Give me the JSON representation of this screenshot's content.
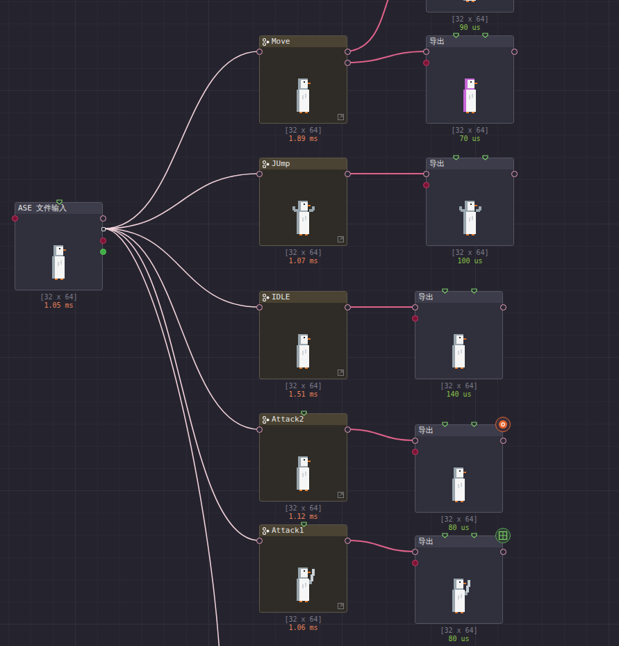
{
  "canvas": {
    "nodes": [
      {
        "title": "",
        "kind": "partial",
        "size": "[32 x 64]",
        "time": "90 us",
        "time_color": "#8bc34a",
        "sprite": "idle",
        "outputs": 1,
        "top_port": false,
        "badge": "none"
      },
      {
        "title": "Move",
        "kind": "animation",
        "size": "[32 x 64]",
        "time": "1.89 ms",
        "time_color": "#e8825a",
        "sprite": "idle",
        "outputs": 2,
        "top_port": false,
        "badge": "none"
      },
      {
        "title": "导出",
        "kind": "export",
        "size": "[32 x 64]",
        "time": "70 us",
        "time_color": "#8bc34a",
        "sprite": "tinted",
        "outputs": 1,
        "top_port": true,
        "badge": "none"
      },
      {
        "title": "JUmp",
        "kind": "animation",
        "size": "[32 x 64]",
        "time": "1.07 ms",
        "time_color": "#e8825a",
        "sprite": "wings",
        "outputs": 1,
        "top_port": false,
        "badge": "none"
      },
      {
        "title": "导出",
        "kind": "export",
        "size": "[32 x 64]",
        "time": "100 us",
        "time_color": "#8bc34a",
        "sprite": "wings",
        "outputs": 1,
        "top_port": true,
        "badge": "none"
      },
      {
        "title": "ASE 文件输入",
        "kind": "input",
        "size": "[32 x 64]",
        "time": "1.05 ms",
        "time_color": "#e8825a",
        "sprite": "idle",
        "outputs": 4,
        "top_port": true,
        "badge": "none"
      },
      {
        "title": "IDLE",
        "kind": "animation",
        "size": "[32 x 64]",
        "time": "1.51 ms",
        "time_color": "#e8825a",
        "sprite": "idle",
        "outputs": 1,
        "top_port": false,
        "badge": "none"
      },
      {
        "title": "导出",
        "kind": "export",
        "size": "[32 x 64]",
        "time": "140 us",
        "time_color": "#8bc34a",
        "sprite": "idle",
        "outputs": 1,
        "top_port": true,
        "badge": "none"
      },
      {
        "title": "Attack2",
        "kind": "animation",
        "size": "[32 x 64]",
        "time": "1.12 ms",
        "time_color": "#e8825a",
        "sprite": "idle",
        "outputs": 1,
        "top_port": true,
        "badge": "none"
      },
      {
        "title": "导出",
        "kind": "export",
        "size": "[32 x 64]",
        "time": "80 us",
        "time_color": "#8bc34a",
        "sprite": "idle",
        "outputs": 1,
        "top_port": true,
        "badge": "eye"
      },
      {
        "title": "Attack1",
        "kind": "animation",
        "size": "[32 x 64]",
        "time": "1.06 ms",
        "time_color": "#e8825a",
        "sprite": "sword",
        "outputs": 1,
        "top_port": true,
        "badge": "none"
      },
      {
        "title": "导出",
        "kind": "export",
        "size": "[32 x 64]",
        "time": "80 us",
        "time_color": "#8bc34a",
        "sprite": "sword",
        "outputs": 1,
        "top_port": true,
        "badge": "grid"
      }
    ]
  }
}
